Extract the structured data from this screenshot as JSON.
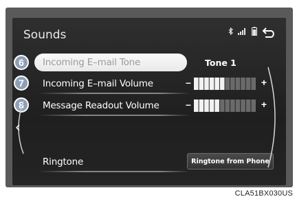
{
  "screen": {
    "title": "Sounds"
  },
  "status_icons": [
    "bluetooth-icon",
    "signal-icon",
    "battery-icon",
    "back-icon"
  ],
  "rows": [
    {
      "callout": "6",
      "label": "Incoming E–mail Tone",
      "value": "Tone 1",
      "selected": true
    },
    {
      "callout": "7",
      "label": "Incoming E–mail Volume",
      "volume_minus": "–",
      "volume_plus": "+",
      "volume_level": 6,
      "volume_max": 12
    },
    {
      "callout": "8",
      "label": "Message Readout Volume",
      "volume_minus": "–",
      "volume_plus": "+",
      "volume_level": 5,
      "volume_max": 12
    },
    {
      "label": "Ringtone",
      "button": "Ringtone from Phone"
    }
  ],
  "figure_code": "CLA51BX030US",
  "colors": {
    "callout": "#8fa0b6",
    "screen_bg": "#262626",
    "bezel": "#5a5a5a"
  }
}
